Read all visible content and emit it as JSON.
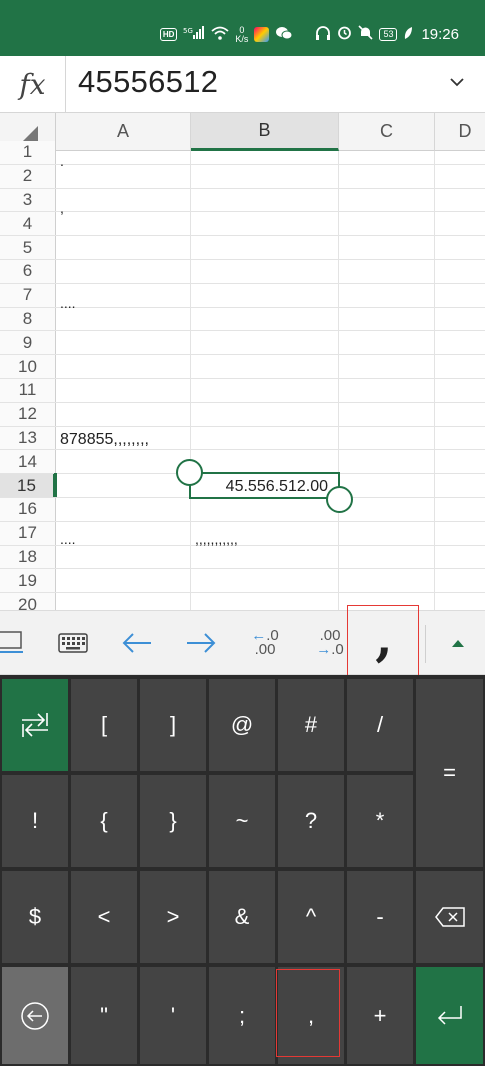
{
  "status_bar": {
    "hd_label": "HD",
    "signal_label": "5G",
    "net_speed": "0",
    "net_unit": "K/s",
    "battery": "53",
    "time": "19:26"
  },
  "formula_bar": {
    "fx_label": "fx",
    "value": "45556512"
  },
  "grid": {
    "columns": [
      "A",
      "B",
      "C",
      "D"
    ],
    "active_column": "B",
    "rows": [
      "1",
      "2",
      "3",
      "4",
      "5",
      "6",
      "7",
      "8",
      "9",
      "10",
      "11",
      "12",
      "13",
      "14",
      "15",
      "16",
      "17",
      "18",
      "19",
      "20"
    ],
    "active_row": "15",
    "cells": {
      "A1": ".",
      "A3": ",",
      "A7": "....",
      "A13": "878855,,,,,,,,",
      "A17": "....",
      "B17": ",,,,,,,,,,,",
      "B15": "45.556.512.00"
    }
  },
  "toolbar": {
    "dec_increase_top": ".0",
    "dec_increase_bottom": ".00",
    "dec_decrease_top": ".00",
    "dec_decrease_bottom": ".0",
    "comma_style_label": ","
  },
  "keyboard": {
    "rows": [
      [
        "[",
        "]",
        "@",
        "#",
        "/"
      ],
      [
        "!",
        "{",
        "}",
        "~",
        "?",
        "*"
      ],
      [
        "$",
        "<",
        ">",
        "&",
        "^",
        "-"
      ],
      [
        "\"",
        "'",
        ";",
        ",",
        "+"
      ]
    ],
    "equals": "="
  },
  "colors": {
    "accent_green": "#217346",
    "highlight_red": "#e53935",
    "arrow_blue": "#3d8fd6"
  }
}
